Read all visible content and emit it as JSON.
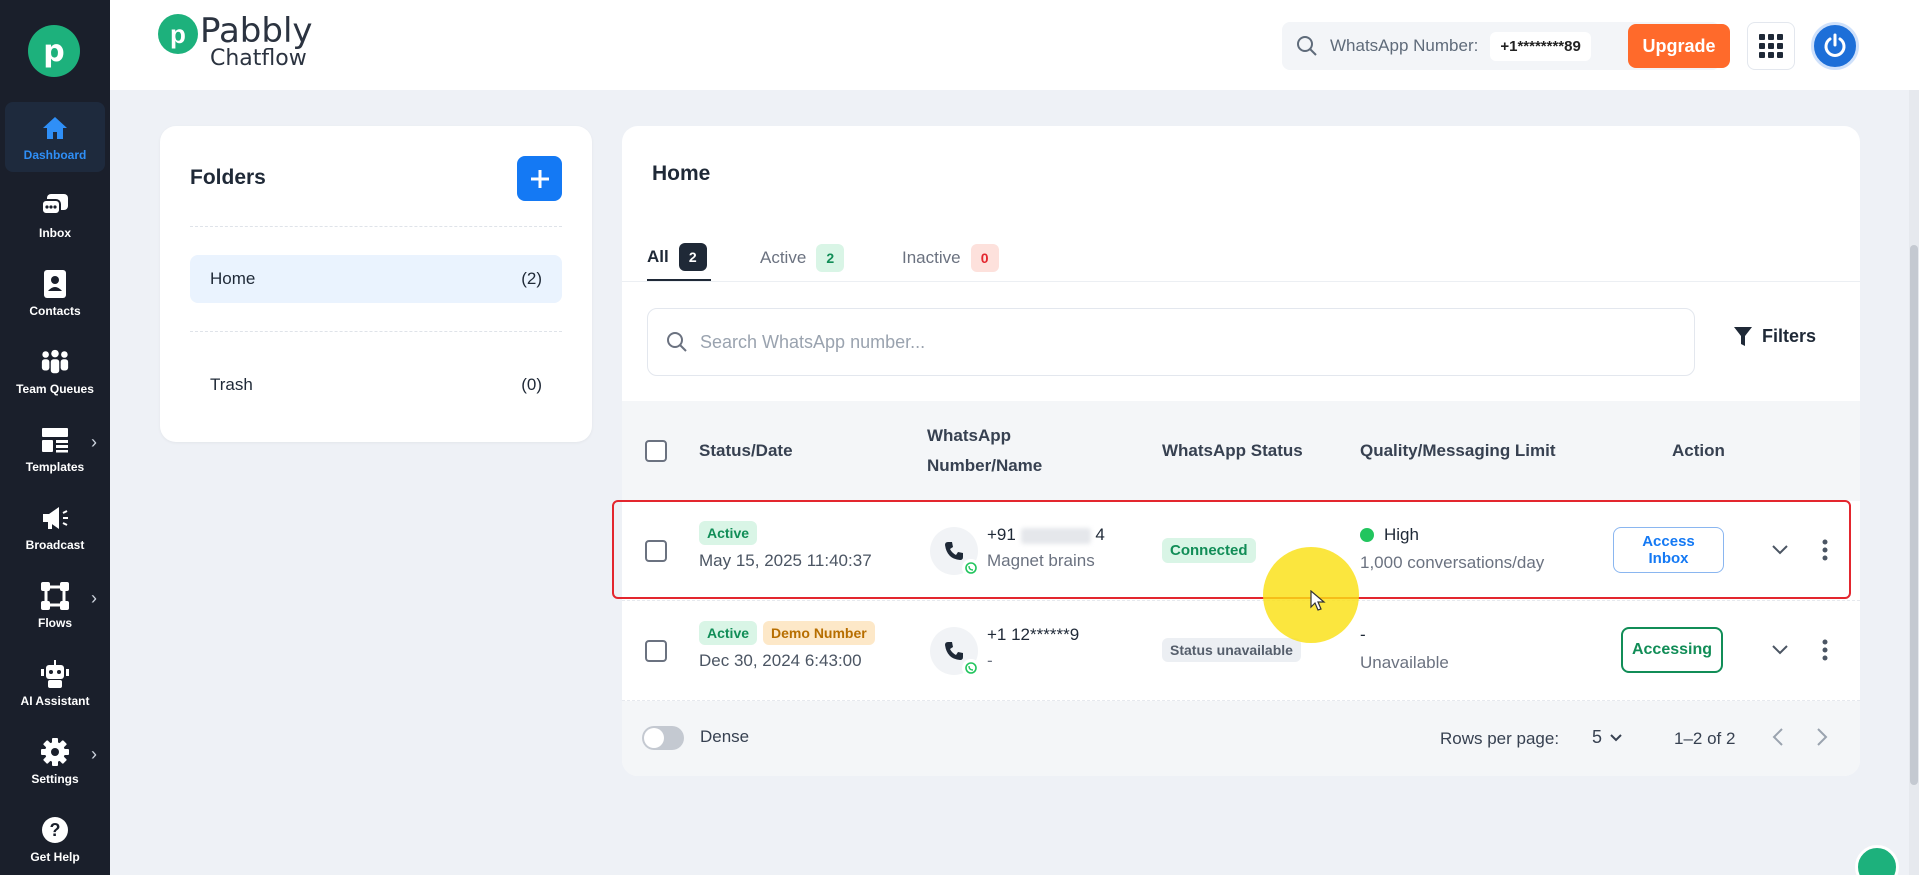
{
  "brand": {
    "name": "Pabbly",
    "sub": "Chatflow"
  },
  "sidebar": {
    "items": [
      {
        "label": "Dashboard",
        "icon": "home-icon"
      },
      {
        "label": "Inbox",
        "icon": "chat-icon"
      },
      {
        "label": "Contacts",
        "icon": "contact-card-icon"
      },
      {
        "label": "Team Queues",
        "icon": "team-icon"
      },
      {
        "label": "Templates",
        "icon": "template-icon"
      },
      {
        "label": "Broadcast",
        "icon": "megaphone-icon"
      },
      {
        "label": "Flows",
        "icon": "flow-icon"
      },
      {
        "label": "AI Assistant",
        "icon": "robot-icon"
      },
      {
        "label": "Settings",
        "icon": "gear-icon"
      },
      {
        "label": "Get Help",
        "icon": "help-icon"
      }
    ]
  },
  "header": {
    "whatsapp_label": "WhatsApp Number:",
    "whatsapp_value": "+1********89",
    "upgrade_label": "Upgrade"
  },
  "folders": {
    "title": "Folders",
    "items": [
      {
        "name": "Home",
        "count": "(2)"
      },
      {
        "name": "Trash",
        "count": "(0)"
      }
    ]
  },
  "main": {
    "title": "Home",
    "tabs": [
      {
        "label": "All",
        "count": "2",
        "color": "#1f2937"
      },
      {
        "label": "Active",
        "count": "2",
        "color": "#118d57"
      },
      {
        "label": "Inactive",
        "count": "0",
        "color": "#e3262e"
      }
    ],
    "search_placeholder": "Search WhatsApp number...",
    "filters_label": "Filters",
    "columns": {
      "status_date": "Status/Date",
      "number_line1": "WhatsApp",
      "number_line2": "Number/Name",
      "wa_status": "WhatsApp Status",
      "quality": "Quality/Messaging Limit",
      "action": "Action"
    },
    "rows": [
      {
        "status": "Active",
        "date": "May 15, 2025 11:40:37",
        "number_prefix": "+91",
        "number_suffix": "4",
        "name": "Magnet brains",
        "wa_status": "Connected",
        "quality": "High",
        "limit": "1,000 conversations/day",
        "action_line1": "Access",
        "action_line2": "Inbox"
      },
      {
        "status": "Active",
        "extra_badge": "Demo Number",
        "date": "Dec 30, 2024 6:43:00",
        "number": "+1 12******9",
        "name": "-",
        "wa_status": "Status unavailable",
        "quality": "-",
        "limit": "Unavailable",
        "action": "Accessing"
      }
    ],
    "footer": {
      "dense_label": "Dense",
      "rows_per_page_label": "Rows per page:",
      "rows_per_page": "5",
      "range": "1–2 of 2"
    }
  },
  "colors": {
    "accent": "#1479f4",
    "upgrade": "#ff6a2b",
    "sidebar": "#1a1f2b",
    "success": "#118d57"
  }
}
